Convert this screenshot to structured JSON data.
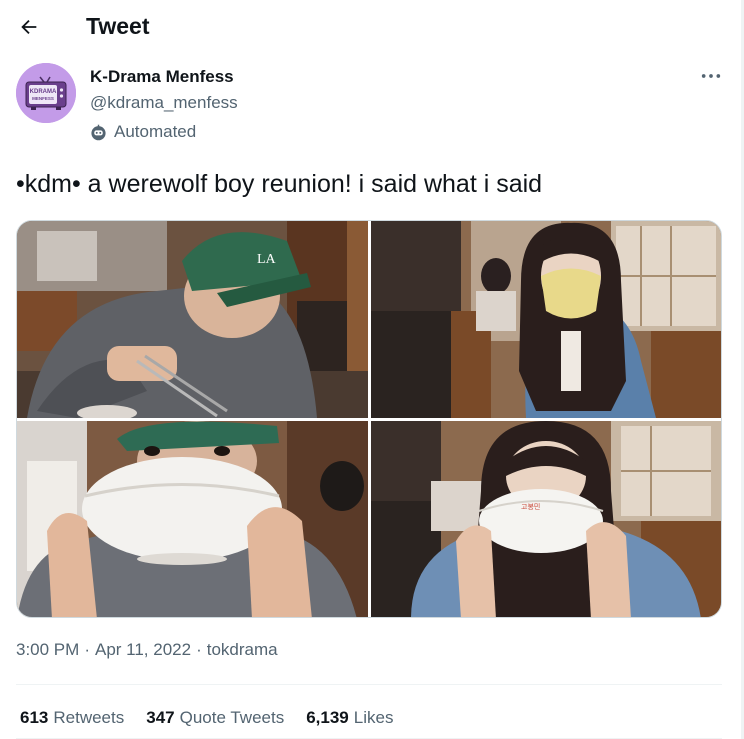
{
  "header": {
    "title": "Tweet"
  },
  "author": {
    "name": "K-Drama Menfess",
    "handle": "@kdrama_menfess",
    "label": "Automated",
    "avatar_text": [
      "KDRAMA",
      "MENFESS"
    ]
  },
  "tweet": {
    "text": "•kdm• a werewolf boy reunion! i said what i said"
  },
  "meta": {
    "time": "3:00 PM",
    "sep1": "·",
    "date": "Apr 11, 2022",
    "sep2": "·",
    "source": "tokdrama"
  },
  "stats": {
    "retweets_count": "613",
    "retweets_label": "Retweets",
    "quotes_count": "347",
    "quotes_label": "Quote Tweets",
    "likes_count": "6,139",
    "likes_label": "Likes"
  },
  "media": {
    "cap_logo": "LA",
    "bowl_text": "고봉민"
  },
  "colors": {
    "primary_text": "#0f1419",
    "secondary_text": "#536471",
    "avatar_bg": "#c39be8",
    "border": "#cfd9de"
  }
}
